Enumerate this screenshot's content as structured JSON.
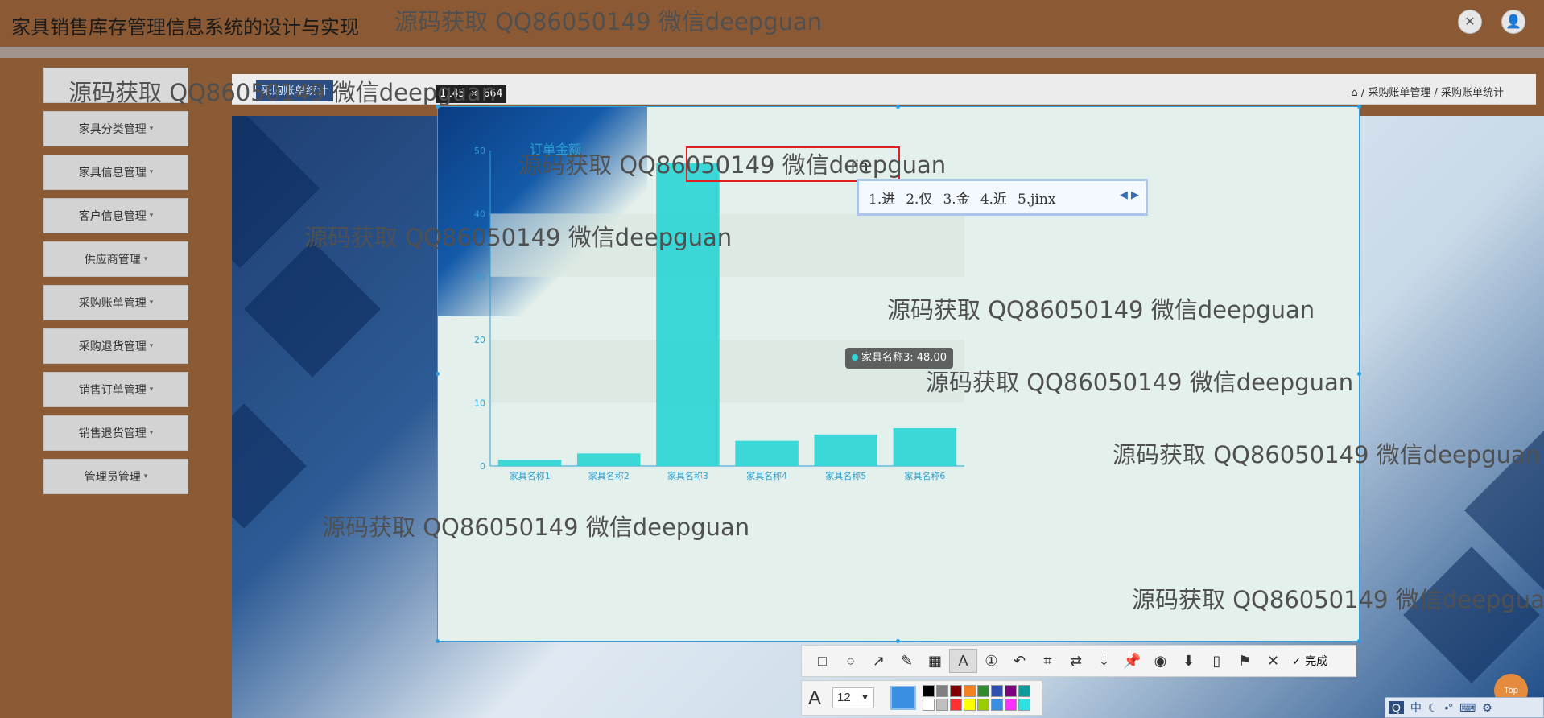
{
  "app": {
    "title": "家具销售库存管理信息系统的设计与实现"
  },
  "header_icons": [
    "expand-icon",
    "user-icon"
  ],
  "watermark_text": "源码获取 QQ86050149 微信deepguan",
  "sidebar": {
    "items": [
      {
        "label": "家具分类管理"
      },
      {
        "label": "家具信息管理"
      },
      {
        "label": "客户信息管理"
      },
      {
        "label": "供应商管理"
      },
      {
        "label": "采购账单管理"
      },
      {
        "label": "采购退货管理"
      },
      {
        "label": "销售订单管理"
      },
      {
        "label": "销售退货管理"
      },
      {
        "label": "管理员管理"
      }
    ]
  },
  "breadcrumb": {
    "tab": "采购账单统计",
    "path": "/ 采购账单管理 / 采购账单统计"
  },
  "capture": {
    "size_label": "1145 × 664"
  },
  "chart_data": {
    "type": "bar",
    "series_name": "订单金额",
    "categories": [
      "家具名称1",
      "家具名称2",
      "家具名称3",
      "家具名称4",
      "家具名称5",
      "家具名称6"
    ],
    "values": [
      1,
      2,
      48,
      4,
      5,
      6
    ],
    "ylim": [
      0,
      50
    ],
    "yticks": [
      0,
      10,
      20,
      30,
      40,
      50
    ],
    "bar_color": "#31d6d6",
    "axis_color": "#2ba0d0"
  },
  "tooltip": {
    "text": "家具名称3: 48.00"
  },
  "annotation": {
    "typed": "jin"
  },
  "ime": {
    "candidates": [
      "1.进",
      "2.仅",
      "3.金",
      "4.近",
      "5.jinx"
    ]
  },
  "toolbar": {
    "tools": [
      "rectangle-icon",
      "ellipse-icon",
      "arrow-icon",
      "pencil-icon",
      "mosaic-icon",
      "text-icon",
      "number-icon",
      "undo-icon",
      "ocr-icon",
      "translate-icon",
      "long-capture-icon",
      "pin-icon",
      "record-icon",
      "download-icon",
      "save-icon",
      "bookmark-icon",
      "close-icon"
    ],
    "done_label": "完成",
    "font_size": "12",
    "current_color": "#3b8fe3",
    "palette": [
      "#000000",
      "#808080",
      "#800000",
      "#f58220",
      "#2e8b2e",
      "#2f4faf",
      "#800080",
      "#109a9a",
      "#ffffff",
      "#c0c0c0",
      "#ff3030",
      "#ffff00",
      "#99cc00",
      "#3b8fe3",
      "#ff30ff",
      "#30e0e0"
    ]
  },
  "scroll_top_label": "Top",
  "tray": {
    "items": [
      "中",
      "☾",
      "•°",
      "⌨",
      "⚙"
    ]
  }
}
